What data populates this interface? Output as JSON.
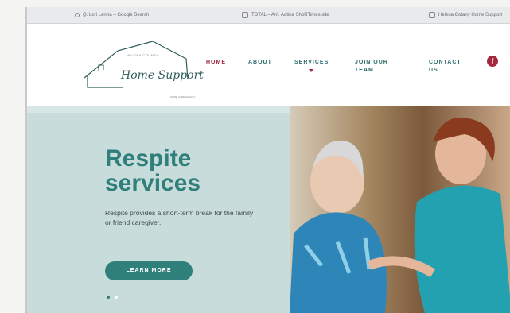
{
  "tabs": [
    {
      "label": "Q. Lori Lerma – Google Search"
    },
    {
      "label": "TOTAL – Am. Aotina ShoRTimes site"
    },
    {
      "label": "Helena Cotany Home Support"
    }
  ],
  "logo": {
    "tagline": "HELENA COUNTY",
    "name": "Home Support",
    "subline": "HOME CARE AGENCY"
  },
  "nav": {
    "items": [
      {
        "label": "HOME",
        "active": true
      },
      {
        "label": "ABOUT"
      },
      {
        "label": "SERVICES"
      },
      {
        "label": "JOIN OUR\nTEAM"
      },
      {
        "label": "CONTACT\nUS"
      }
    ],
    "facebook_label": "f"
  },
  "hero": {
    "title": "Respite services",
    "description": "Respite provides a short-term break for the family or friend caregiver.",
    "button_label": "LEARN MORE",
    "slides": 2,
    "active_slide": 0
  },
  "colors": {
    "accent": "#2f7f7b",
    "brand": "#a2283e",
    "panel": "#c8dbdb"
  }
}
